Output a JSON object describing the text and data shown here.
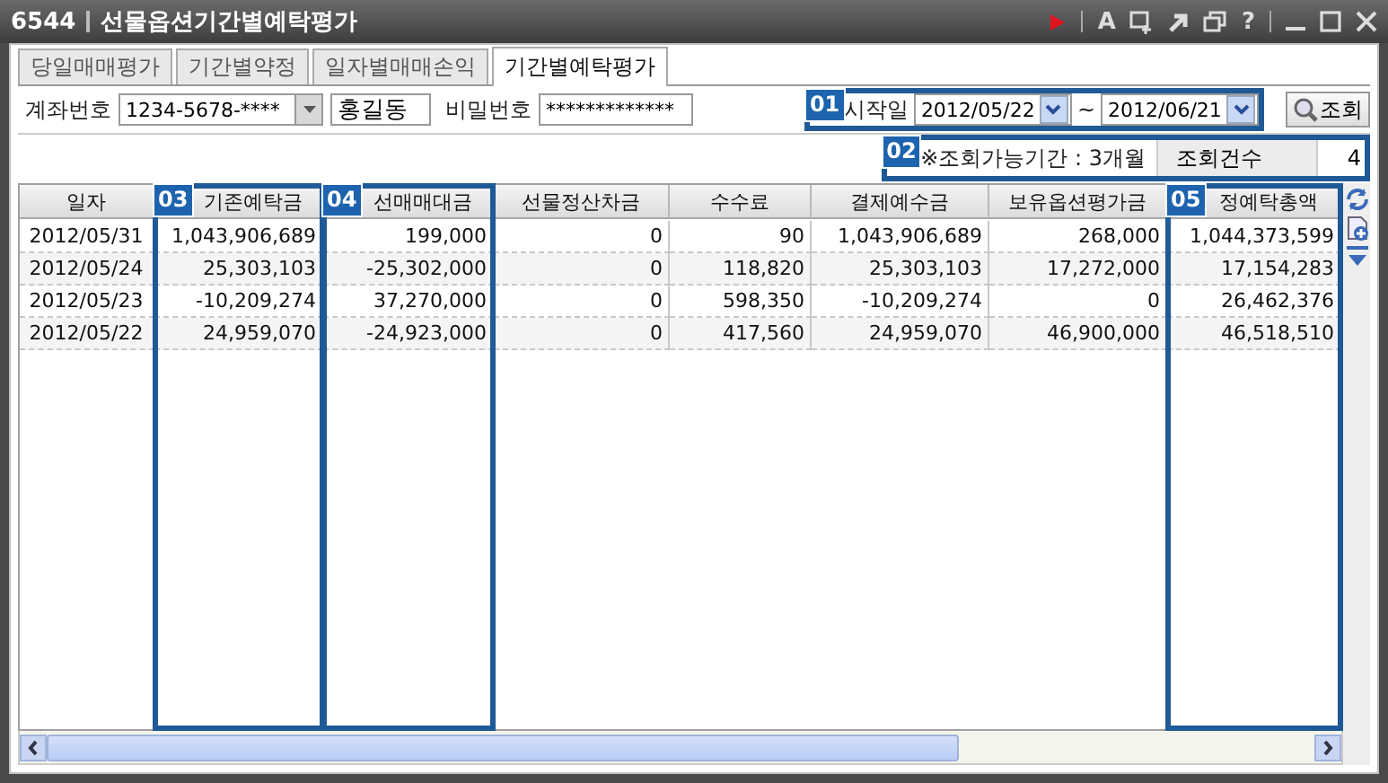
{
  "window": {
    "number": "6544",
    "title": "선물옵션기간별예탁평가",
    "font_button": "A",
    "help_button": "?"
  },
  "tabs": [
    {
      "label": "당일매매평가",
      "selected": false
    },
    {
      "label": "기간별약정",
      "selected": false
    },
    {
      "label": "일자별매매손익",
      "selected": false
    },
    {
      "label": "기간별예탁평가",
      "selected": true
    }
  ],
  "account": {
    "label": "계좌번호",
    "value": "1234-5678-****",
    "name": "홍길동",
    "password_label": "비밀번호",
    "password": "*************"
  },
  "period": {
    "start_label": "시작일",
    "start": "2012/05/22",
    "separator": "~",
    "end": "2012/06/21",
    "search_button": "조회"
  },
  "info": {
    "note": "※조회가능기간 : 3개월",
    "count_label": "조회건수",
    "count": "4"
  },
  "table": {
    "columns": [
      "일자",
      "기존예탁금",
      "선매매대금",
      "선물정산차금",
      "수수료",
      "결제예수금",
      "보유옵션평가금",
      "정예탁총액"
    ],
    "rows": [
      [
        "2012/05/31",
        "1,043,906,689",
        "199,000",
        "0",
        "90",
        "1,043,906,689",
        "268,000",
        "1,044,373,599"
      ],
      [
        "2012/05/24",
        "25,303,103",
        "-25,302,000",
        "0",
        "118,820",
        "25,303,103",
        "17,272,000",
        "17,154,283"
      ],
      [
        "2012/05/23",
        "-10,209,274",
        "37,270,000",
        "0",
        "598,350",
        "-10,209,274",
        "0",
        "26,462,376"
      ],
      [
        "2012/05/22",
        "24,959,070",
        "-24,923,000",
        "0",
        "417,560",
        "24,959,070",
        "46,900,000",
        "46,518,510"
      ]
    ]
  },
  "callouts": [
    {
      "label": "01"
    },
    {
      "label": "02"
    },
    {
      "label": "03"
    },
    {
      "label": "04"
    },
    {
      "label": "05"
    }
  ]
}
